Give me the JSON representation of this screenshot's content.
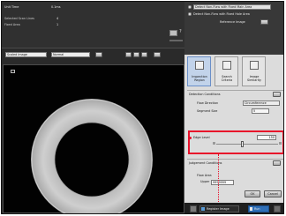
{
  "app": {
    "status_label": "Unit Time",
    "status_value": "0.1ms"
  },
  "left_info": {
    "rows": [
      {
        "label": "Selected Scan Lines",
        "value": "4"
      },
      {
        "label": "Fixed Area",
        "value": "1"
      }
    ]
  },
  "image_toolbar": {
    "mode": "Scaled Image",
    "view": "Normal"
  },
  "right_panel": {
    "radio_options": [
      "Detect Non-Flaw with Fixed Main Area",
      "Detect Non-Flaw with Fixed Hole Area"
    ],
    "reference_label": "Reference Image",
    "tools": [
      {
        "label": "Inspection Region"
      },
      {
        "label": "Search Criteria"
      },
      {
        "label": "Image Similarity"
      }
    ],
    "detection_conditions": {
      "title": "Detection Conditions",
      "flaw_direction_label": "Flaw Direction",
      "flaw_direction_value": "Circumference",
      "segment_size_label": "Segment Size",
      "segment_size_value": "5"
    },
    "edge_level": {
      "label": "Edge Level",
      "value": "150",
      "fraction": 0.42
    },
    "judgement_conditions": {
      "title": "Judgement Conditions",
      "flaw_area_label": "Flaw Area",
      "upper_label": "Upper",
      "upper_value": "9999999"
    },
    "ok_label": "OK",
    "cancel_label": "Cancel"
  },
  "bottom_bar": {
    "save_label": "Register Image",
    "run_label": "Run"
  },
  "colors": {
    "highlight": "#e8102a",
    "panel_bg": "#dcdcdc",
    "accent": "#2f6fb7"
  }
}
